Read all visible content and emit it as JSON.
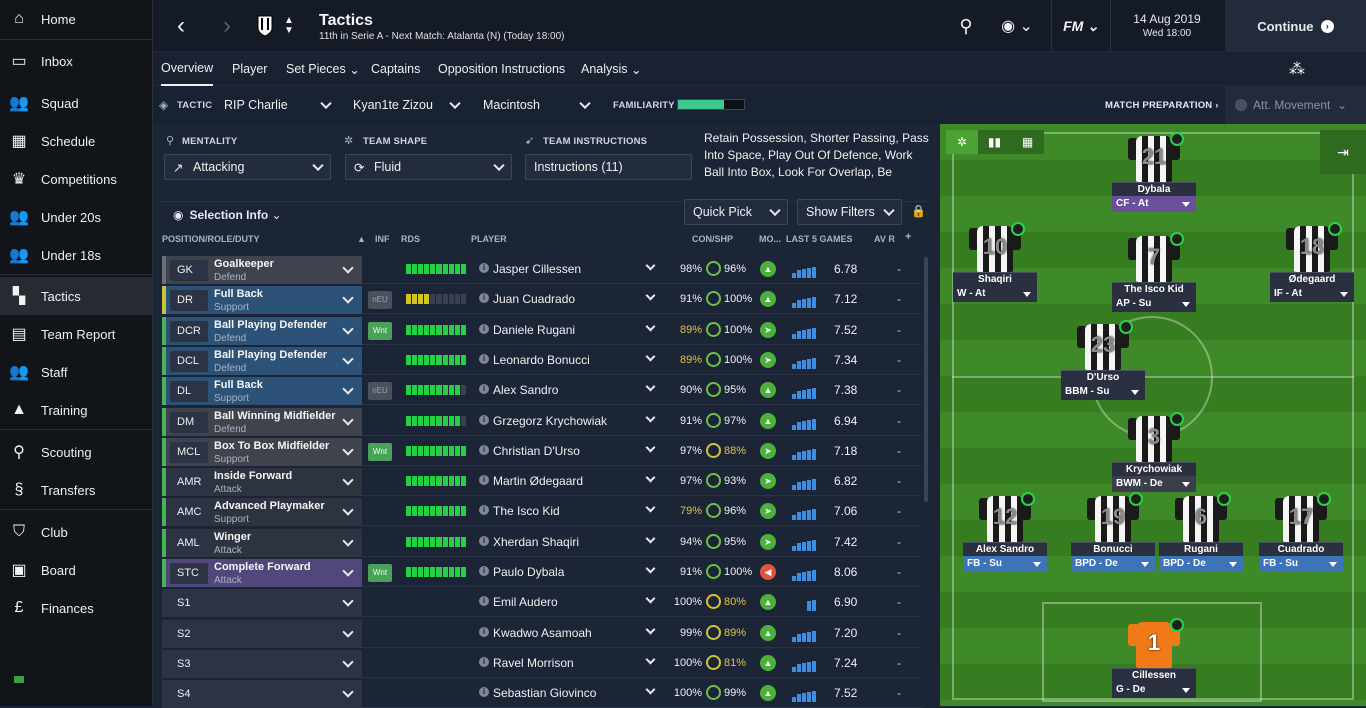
{
  "sidebar": {
    "items": [
      {
        "label": "Home",
        "icon": "home-icon",
        "glyph": "⌂"
      },
      {
        "label": "Inbox",
        "icon": "inbox-icon",
        "glyph": "▭"
      },
      {
        "label": "Squad",
        "icon": "squad-icon",
        "glyph": "👥"
      },
      {
        "label": "Schedule",
        "icon": "calendar-icon",
        "glyph": "▦"
      },
      {
        "label": "Competitions",
        "icon": "trophy-icon",
        "glyph": "♛"
      },
      {
        "label": "Under 20s",
        "icon": "u20-icon",
        "glyph": "👥"
      },
      {
        "label": "Under 18s",
        "icon": "u18-icon",
        "glyph": "👥"
      },
      {
        "label": "Tactics",
        "icon": "tactics-icon",
        "glyph": "▚"
      },
      {
        "label": "Team Report",
        "icon": "report-icon",
        "glyph": "▤"
      },
      {
        "label": "Staff",
        "icon": "staff-icon",
        "glyph": "👥"
      },
      {
        "label": "Training",
        "icon": "training-icon",
        "glyph": "▲"
      },
      {
        "label": "Scouting",
        "icon": "search-icon",
        "glyph": "⚲"
      },
      {
        "label": "Transfers",
        "icon": "transfers-icon",
        "glyph": "§"
      },
      {
        "label": "Club",
        "icon": "shield-icon",
        "glyph": "⛉"
      },
      {
        "label": "Board",
        "icon": "briefcase-icon",
        "glyph": "▣"
      },
      {
        "label": "Finances",
        "icon": "coin-icon",
        "glyph": "£"
      }
    ]
  },
  "header": {
    "title": "Tactics",
    "subtitle": "11th in Serie A - Next Match: Atalanta (N) (Today 18:00)",
    "date": "14 Aug 2019",
    "time": "Wed 18:00",
    "continue": "Continue",
    "fm": "FM"
  },
  "tabs": [
    "Overview",
    "Player",
    "Set Pieces",
    "Captains",
    "Opposition Instructions",
    "Analysis"
  ],
  "tacticbar": {
    "tactic_label": "TACTIC",
    "tactic1": "RIP Charlie",
    "tactic2": "Kyan1te Zizou",
    "tactic3": "Macintosh",
    "familiarity_label": "FAMILIARITY",
    "familiarity": 0.7,
    "match_prep": "MATCH PREPARATION ›",
    "att_movement": "Att. Movement"
  },
  "settings": {
    "mentality_label": "MENTALITY",
    "mentality": "Attacking",
    "shape_label": "TEAM SHAPE",
    "shape": "Fluid",
    "ti_label": "TEAM INSTRUCTIONS",
    "ti": "Instructions (11)",
    "ti_desc": "Retain Possession, Shorter Passing, Pass Into Space, Play Out Of Defence, Work Ball Into Box, Look For Overlap, Be More..."
  },
  "list": {
    "selection_info": "Selection Info",
    "quick_pick": "Quick Pick",
    "show_filters": "Show Filters",
    "headers": {
      "pos": "POSITION/ROLE/DUTY",
      "inf": "INF",
      "rds": "RDS",
      "player": "PLAYER",
      "con": "CON/SHP",
      "mo": "MO...",
      "last5": "LAST 5 GAMES",
      "avr": "AV R"
    },
    "rows": [
      {
        "code": "GK",
        "role": "Goalkeeper",
        "duty": "Defend",
        "color": "#6b6f78",
        "inf": "",
        "player": "Jasper Cillessen",
        "con": "98%",
        "shp": "96%",
        "avr": "6.78",
        "rds": 10,
        "ry": 0,
        "mo": "▲"
      },
      {
        "code": "DR",
        "role": "Full Back",
        "duty": "Support",
        "color": "#c2c443",
        "inf": "nEU",
        "player": "Juan Cuadrado",
        "con": "91%",
        "shp": "100%",
        "avr": "7.12",
        "rds": 4,
        "ry": 1,
        "mo": "▲"
      },
      {
        "code": "DCR",
        "role": "Ball Playing Defender",
        "duty": "Defend",
        "color": "#4ab35a",
        "inf": "Wnt",
        "player": "Daniele Rugani",
        "con": "89%",
        "shp": "100%",
        "avr": "7.52",
        "rds": 10,
        "ry": 0,
        "mo": "➤"
      },
      {
        "code": "DCL",
        "role": "Ball Playing Defender",
        "duty": "Defend",
        "color": "#4ab35a",
        "inf": "",
        "player": "Leonardo Bonucci",
        "con": "89%",
        "shp": "100%",
        "avr": "7.34",
        "rds": 10,
        "ry": 0,
        "mo": "➤"
      },
      {
        "code": "DL",
        "role": "Full Back",
        "duty": "Support",
        "color": "#4ab35a",
        "inf": "nEU",
        "player": "Alex Sandro",
        "con": "90%",
        "shp": "95%",
        "avr": "7.38",
        "rds": 9,
        "ry": 0,
        "mo": "▲"
      },
      {
        "code": "DM",
        "role": "Ball Winning Midfielder",
        "duty": "Defend",
        "color": "#4ab35a",
        "inf": "",
        "player": "Grzegorz Krychowiak",
        "con": "91%",
        "shp": "97%",
        "avr": "6.94",
        "rds": 9,
        "ry": 0,
        "mo": "▲"
      },
      {
        "code": "MCL",
        "role": "Box To Box Midfielder",
        "duty": "Support",
        "color": "#4ab35a",
        "inf": "Wnt",
        "player": "Christian D'Urso",
        "con": "97%",
        "shp": "88%",
        "avr": "7.18",
        "rds": 10,
        "ry": 0,
        "mo": "➤"
      },
      {
        "code": "AMR",
        "role": "Inside Forward",
        "duty": "Attack",
        "color": "#4ab35a",
        "inf": "",
        "player": "Martin Ødegaard",
        "con": "97%",
        "shp": "93%",
        "avr": "6.82",
        "rds": 10,
        "ry": 0,
        "mo": "➤"
      },
      {
        "code": "AMC",
        "role": "Advanced Playmaker",
        "duty": "Support",
        "color": "#4ab35a",
        "inf": "",
        "player": "The Isco Kid",
        "con": "79%",
        "shp": "96%",
        "avr": "7.06",
        "rds": 10,
        "ry": 0,
        "mo": "➤"
      },
      {
        "code": "AML",
        "role": "Winger",
        "duty": "Attack",
        "color": "#4ab35a",
        "inf": "",
        "player": "Xherdan Shaqiri",
        "con": "94%",
        "shp": "95%",
        "avr": "7.42",
        "rds": 10,
        "ry": 0,
        "mo": "➤"
      },
      {
        "code": "STC",
        "role": "Complete Forward",
        "duty": "Attack",
        "color": "#4ab35a",
        "inf": "Wnt",
        "player": "Paulo Dybala",
        "con": "91%",
        "shp": "100%",
        "avr": "8.06",
        "rds": 10,
        "ry": 0,
        "mo": "◀"
      },
      {
        "code": "S1",
        "role": "",
        "duty": "",
        "color": "#2b3344",
        "inf": "",
        "player": "Emil Audero",
        "con": "100%",
        "shp": "80%",
        "avr": "6.90",
        "rds": 0,
        "ry": 0,
        "mo": "▲"
      },
      {
        "code": "S2",
        "role": "",
        "duty": "",
        "color": "#2b3344",
        "inf": "",
        "player": "Kwadwo Asamoah",
        "con": "99%",
        "shp": "89%",
        "avr": "7.20",
        "rds": 0,
        "ry": 0,
        "mo": "▲"
      },
      {
        "code": "S3",
        "role": "",
        "duty": "",
        "color": "#2b3344",
        "inf": "",
        "player": "Ravel Morrison",
        "con": "100%",
        "shp": "81%",
        "avr": "7.24",
        "rds": 0,
        "ry": 0,
        "mo": "▲"
      },
      {
        "code": "S4",
        "role": "",
        "duty": "",
        "color": "#2b3344",
        "inf": "",
        "player": "Sebastian Giovinco",
        "con": "100%",
        "shp": "99%",
        "avr": "7.52",
        "rds": 0,
        "ry": 0,
        "mo": "▲"
      }
    ],
    "avr_dash": "-"
  },
  "pitch": {
    "players": [
      {
        "num": "21",
        "name": "Dybala",
        "role": "CF - At",
        "rc": "#6a4f9a"
      },
      {
        "num": "10",
        "name": "Shaqiri",
        "role": "W - At",
        "rc": "#2a3040"
      },
      {
        "num": "7",
        "name": "The Isco Kid",
        "role": "AP - Su",
        "rc": "#2a3040"
      },
      {
        "num": "18",
        "name": "Ødegaard",
        "role": "IF - At",
        "rc": "#2a3040"
      },
      {
        "num": "23",
        "name": "D'Urso",
        "role": "BBM - Su",
        "rc": "#2a3040"
      },
      {
        "num": "3",
        "name": "Krychowiak",
        "role": "BWM - De",
        "rc": "#3a3f4a"
      },
      {
        "num": "12",
        "name": "Alex Sandro",
        "role": "FB - Su",
        "rc": "#3d74b8"
      },
      {
        "num": "19",
        "name": "Bonucci",
        "role": "BPD - De",
        "rc": "#3d74b8"
      },
      {
        "num": "6",
        "name": "Rugani",
        "role": "BPD - De",
        "rc": "#3d74b8"
      },
      {
        "num": "17",
        "name": "Cuadrado",
        "role": "FB - Su",
        "rc": "#3d74b8"
      },
      {
        "num": "1",
        "name": "Cillessen",
        "role": "G - De",
        "rc": "#2a3040"
      }
    ]
  }
}
